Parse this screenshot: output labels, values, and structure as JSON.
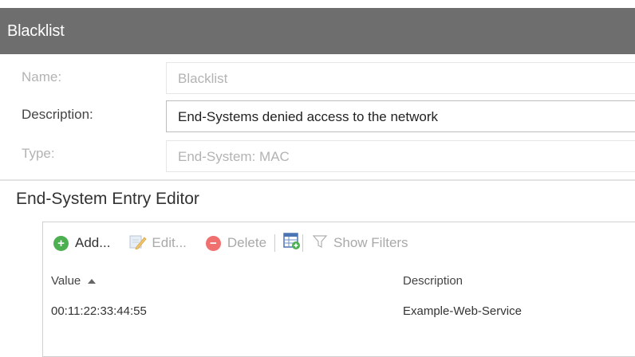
{
  "window": {
    "title": "Blacklist"
  },
  "form": {
    "name_label": "Name:",
    "name_value": "Blacklist",
    "description_label": "Description:",
    "description_value": "End-Systems denied access to the network",
    "type_label": "Type:",
    "type_value": "End-System: MAC"
  },
  "editor": {
    "title": "End-System Entry Editor",
    "toolbar": {
      "add_label": "Add...",
      "edit_label": "Edit...",
      "delete_label": "Delete",
      "show_filters_label": "Show Filters"
    },
    "table": {
      "columns": [
        "Value",
        "Description"
      ],
      "sort_column": "Value",
      "sort_direction": "ascending",
      "rows": [
        {
          "value": "00:11:22:33:44:55",
          "description": "Example-Web-Service"
        }
      ]
    }
  },
  "colors": {
    "titlebar_bg": "#6e6e6e",
    "add_icon": "#4caf50",
    "delete_icon": "#f06f6f"
  },
  "icons": {
    "add": "plus-circle-icon",
    "edit": "edit-pencil-icon",
    "delete": "minus-circle-icon",
    "export": "table-export-icon",
    "filter": "funnel-icon",
    "sort": "sort-ascending-icon"
  }
}
